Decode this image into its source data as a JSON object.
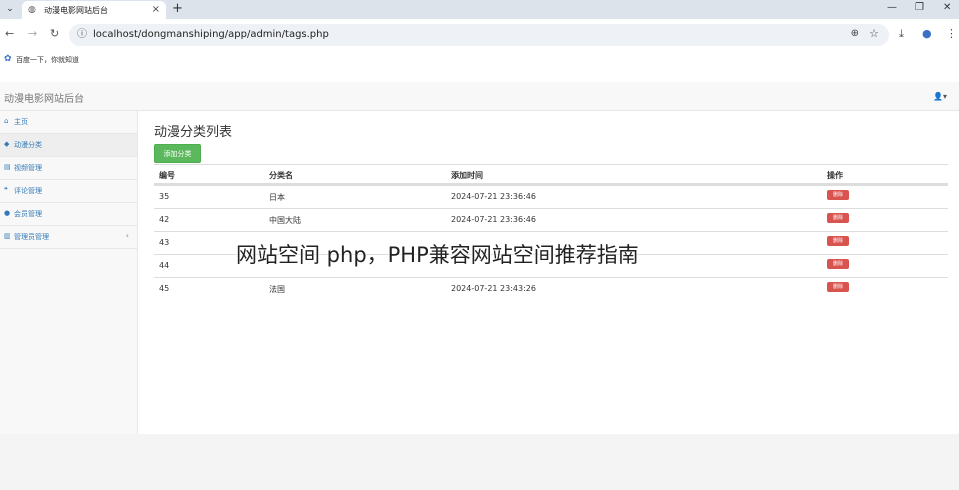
{
  "browser": {
    "tab_title": "动漫电影网站后台",
    "url": "localhost/dongmanshiping/app/admin/tags.php",
    "bookmark_label": "百度一下，你就知道"
  },
  "header": {
    "brand": "动漫电影网站后台"
  },
  "sidebar": {
    "items": [
      {
        "label": "主页"
      },
      {
        "label": "动漫分类"
      },
      {
        "label": "视频管理"
      },
      {
        "label": "评论管理"
      },
      {
        "label": "会员管理"
      },
      {
        "label": "管理员管理"
      }
    ]
  },
  "main": {
    "title": "动漫分类列表",
    "add_button": "添加分类",
    "columns": [
      "编号",
      "分类名",
      "添加时间",
      "操作"
    ],
    "delete_label": "删除",
    "rows": [
      {
        "id": "35",
        "name": "日本",
        "time": "2024-07-21 23:36:46"
      },
      {
        "id": "42",
        "name": "中国大陆",
        "time": "2024-07-21 23:36:46"
      },
      {
        "id": "43",
        "name": "",
        "time": ""
      },
      {
        "id": "44",
        "name": "",
        "time": ""
      },
      {
        "id": "45",
        "name": "法国",
        "time": "2024-07-21 23:43:26"
      }
    ]
  },
  "overlay": {
    "watermark": "网站空间 php，PHP兼容网站空间推荐指南"
  },
  "colors": {
    "accent": "#337ab7",
    "success": "#5cb85c",
    "danger": "#d9534f"
  }
}
